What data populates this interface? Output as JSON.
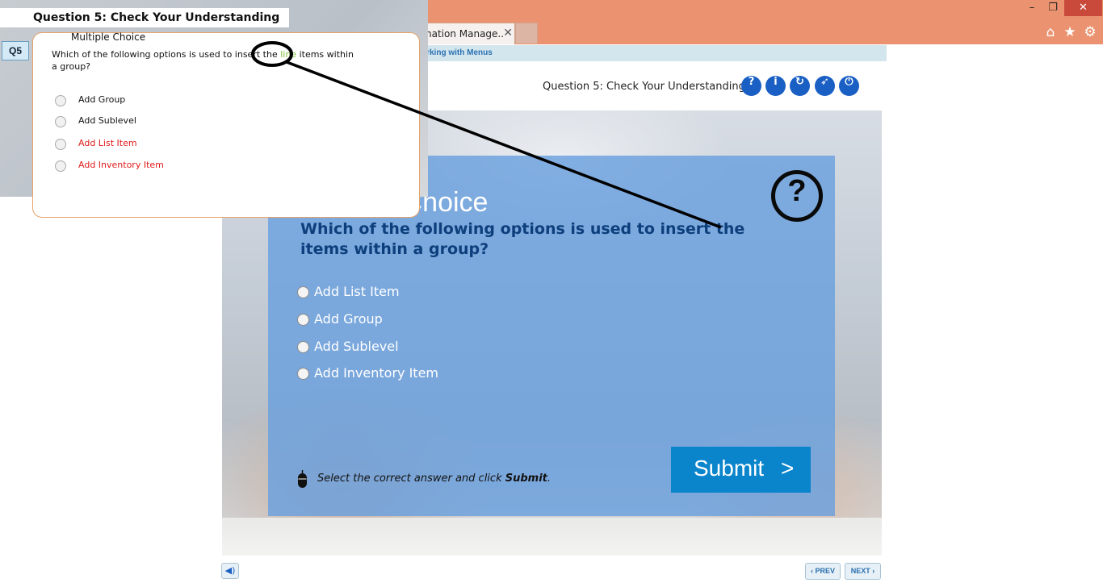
{
  "browser": {
    "tab_label": "nation Manage...",
    "tab_close": "✕",
    "window_controls": [
      "minimize-icon",
      "restore-icon",
      "close-icon"
    ],
    "toolbar_icons": [
      "home-icon",
      "star-icon",
      "gear-icon"
    ]
  },
  "player": {
    "breadcrumb": "orking with Menus",
    "header_title": "Question 5: Check Your Understanding",
    "header_buttons": [
      {
        "icon": "help-icon",
        "glyph": "?"
      },
      {
        "icon": "info-icon",
        "glyph": "i"
      },
      {
        "icon": "replay-icon",
        "glyph": "↻"
      },
      {
        "icon": "compass-icon",
        "glyph": "➶"
      },
      {
        "icon": "power-icon",
        "glyph": "⏻"
      }
    ],
    "question": {
      "heading": "Multiple Choice",
      "text": "Which of the following options is used to insert the items within a group?",
      "options": [
        "Add List Item",
        "Add Group",
        "Add Sublevel",
        "Add Inventory Item"
      ],
      "instruction_prefix": "Select the correct answer and click ",
      "instruction_bold": "Submit",
      "instruction_suffix": ".",
      "submit_label": "Submit",
      "submit_arrow": ">"
    },
    "footer": {
      "prev_label": "‹ PREV",
      "next_label": "NEXT ›"
    }
  },
  "overlay": {
    "title": "Question 5: Check Your Understanding",
    "badge": "Q5",
    "heading": "Multiple Choice",
    "question_before": "Which of the following options is used to insert the ",
    "question_highlight": "line",
    "question_after": " items within a group?",
    "options": [
      {
        "label": "Add Group",
        "color": "normal"
      },
      {
        "label": "Add Sublevel",
        "color": "normal"
      },
      {
        "label": "Add List Item",
        "color": "red"
      },
      {
        "label": "Add Inventory Item",
        "color": "red"
      }
    ]
  },
  "colors": {
    "titlebar": "#eb9370",
    "panel": "#6aa0de",
    "submit": "#0a85cc",
    "header_button": "#1a5fc4",
    "highlight_word": "#7dbf3a",
    "red_option": "#e01b1b"
  }
}
